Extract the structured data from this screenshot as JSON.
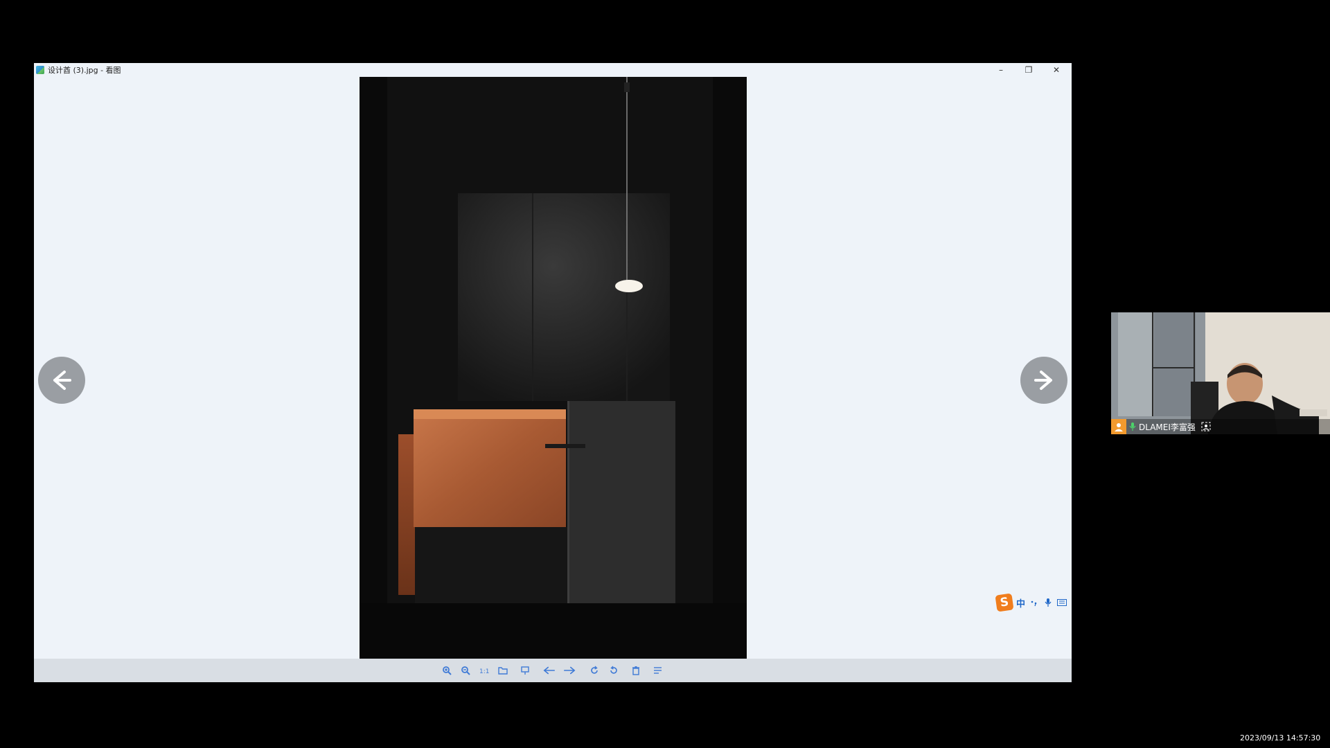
{
  "window": {
    "title": "设计酋 (3).jpg - 看图",
    "controls": {
      "minimize": "–",
      "restore": "❐",
      "close": "✕"
    }
  },
  "image_viewer": {
    "image": "dark-interior-reception-desk-photo",
    "prev_icon": "arrow-left-icon",
    "next_icon": "arrow-right-icon"
  },
  "toolbar": {
    "buttons": [
      {
        "name": "zoom-in-icon",
        "glyph": "+"
      },
      {
        "name": "zoom-out-icon",
        "glyph": "−"
      },
      {
        "name": "actual-size-icon",
        "glyph": "1:1"
      },
      {
        "name": "open-folder-icon",
        "glyph": "▱"
      },
      {
        "name": "slideshow-icon",
        "glyph": "▭"
      },
      {
        "name": "previous-image-icon",
        "glyph": "←"
      },
      {
        "name": "next-image-icon",
        "glyph": "→"
      },
      {
        "name": "rotate-right-icon",
        "glyph": "↻"
      },
      {
        "name": "rotate-left-icon",
        "glyph": "↺"
      },
      {
        "name": "delete-icon",
        "glyph": "🗑"
      },
      {
        "name": "more-menu-icon",
        "glyph": "☰"
      }
    ]
  },
  "ime": {
    "logo": "S",
    "language": "中"
  },
  "video_call": {
    "participant_name": "DLAMEI李富强",
    "accent": "#f29a2e"
  },
  "taskbar": {
    "timestamp": "2023/09/13 14:57:30"
  },
  "colors": {
    "window_bg": "#eef3f9",
    "toolbar_bg": "#d9dee4",
    "toolbar_icon": "#3f7ad6",
    "ime_logo": "#f07d1d",
    "arrow_button": "#9a9ea3"
  }
}
